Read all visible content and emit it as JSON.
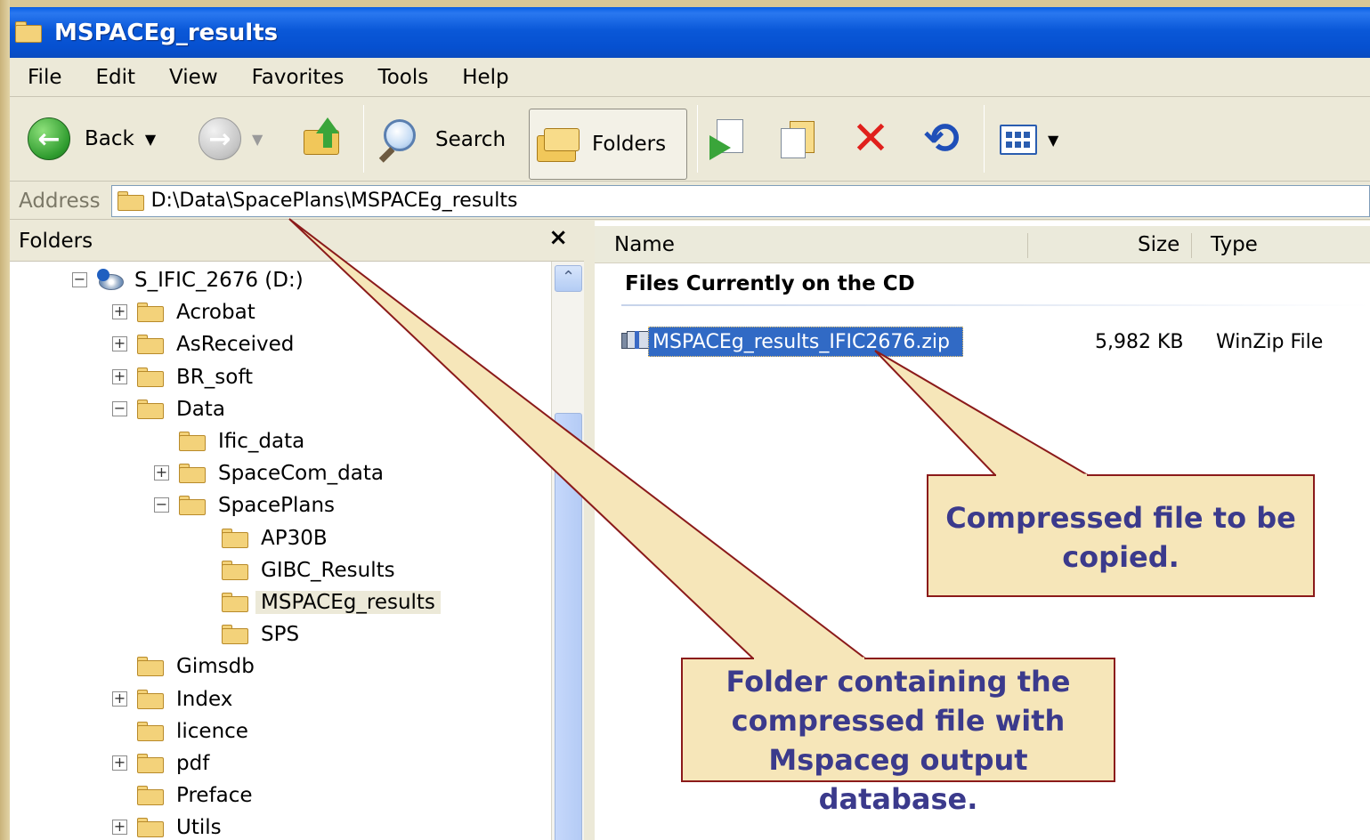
{
  "window": {
    "title": "MSPACEg_results"
  },
  "menu": [
    "File",
    "Edit",
    "View",
    "Favorites",
    "Tools",
    "Help"
  ],
  "toolbar": {
    "back_label": "Back",
    "search_label": "Search",
    "folders_label": "Folders"
  },
  "address": {
    "label": "Address",
    "path": "D:\\Data\\SpacePlans\\MSPACEg_results"
  },
  "folders_pane": {
    "title": "Folders",
    "close": "×",
    "tree": [
      {
        "label": "S_IFIC_2676 (D:)",
        "depth": 0,
        "expander": "−",
        "icon": "drive-icon"
      },
      {
        "label": "Acrobat",
        "depth": 1,
        "expander": "+"
      },
      {
        "label": "AsReceived",
        "depth": 1,
        "expander": "+"
      },
      {
        "label": "BR_soft",
        "depth": 1,
        "expander": "+"
      },
      {
        "label": "Data",
        "depth": 1,
        "expander": "−"
      },
      {
        "label": "Ific_data",
        "depth": 2,
        "expander": ""
      },
      {
        "label": "SpaceCom_data",
        "depth": 2,
        "expander": "+"
      },
      {
        "label": "SpacePlans",
        "depth": 2,
        "expander": "−"
      },
      {
        "label": "AP30B",
        "depth": 3,
        "expander": ""
      },
      {
        "label": "GIBC_Results",
        "depth": 3,
        "expander": ""
      },
      {
        "label": "MSPACEg_results",
        "depth": 3,
        "expander": "",
        "selected": true
      },
      {
        "label": "SPS",
        "depth": 3,
        "expander": ""
      },
      {
        "label": "Gimsdb",
        "depth": 1,
        "expander": ""
      },
      {
        "label": "Index",
        "depth": 1,
        "expander": "+"
      },
      {
        "label": "licence",
        "depth": 1,
        "expander": ""
      },
      {
        "label": "pdf",
        "depth": 1,
        "expander": "+"
      },
      {
        "label": "Preface",
        "depth": 1,
        "expander": ""
      },
      {
        "label": "Utils",
        "depth": 1,
        "expander": "+"
      }
    ]
  },
  "file_list": {
    "columns": {
      "name": "Name",
      "size": "Size",
      "type": "Type"
    },
    "group_title": "Files Currently on the CD",
    "files": [
      {
        "name": "MSPACEg_results_IFIC2676.zip",
        "size": "5,982 KB",
        "type": "WinZip File",
        "selected": true
      }
    ]
  },
  "callouts": {
    "compressed": "Compressed file to be copied.",
    "folder": "Folder containing the compressed file with Mspaceg output database."
  },
  "colors": {
    "titlebar": "#0a58d8",
    "selection": "#316ac5",
    "callout_text": "#3b3a8c",
    "callout_border": "#8b1a1a"
  }
}
